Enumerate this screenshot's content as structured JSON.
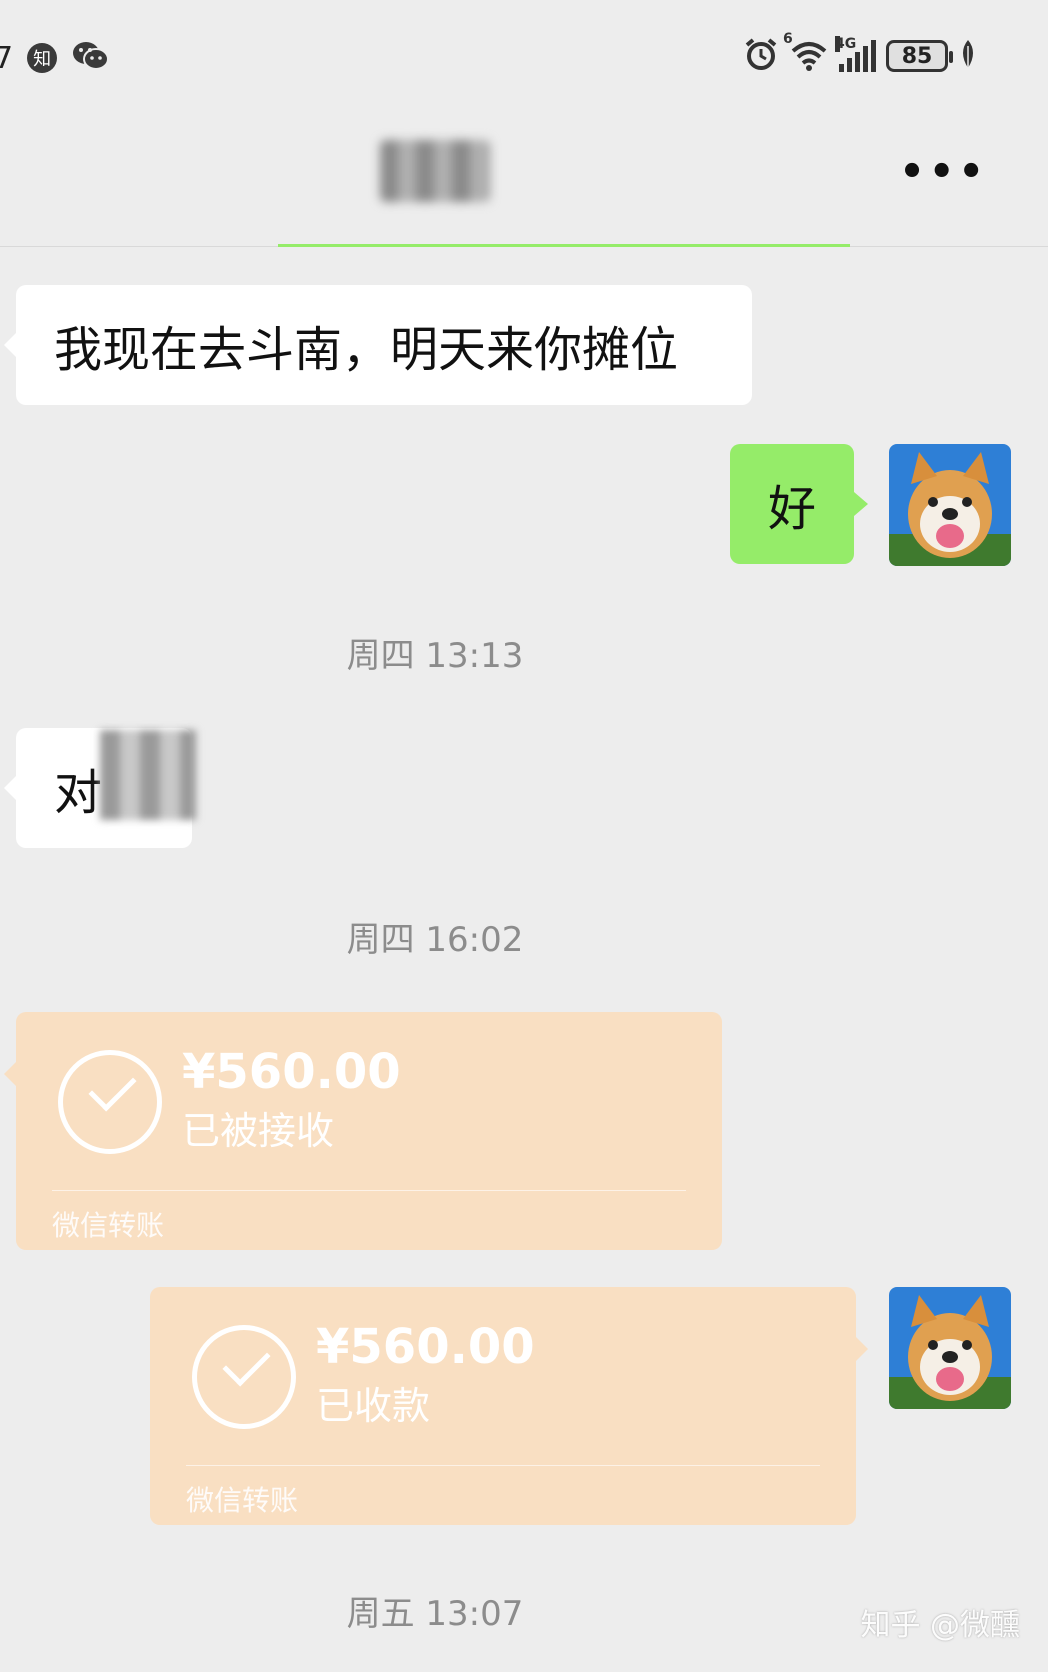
{
  "status_bar": {
    "clip_text": "7",
    "zhihu_label": "知",
    "wifi_label": "6",
    "network_label": "4G",
    "battery": "85"
  },
  "header": {
    "more_label": "•••"
  },
  "messages": [
    {
      "side": "left",
      "text": "我现在去斗南，明天来你摊位"
    },
    {
      "side": "right",
      "text": "好"
    },
    {
      "time": "周四 13:13"
    },
    {
      "side": "left",
      "text": "对"
    },
    {
      "time": "周四 16:02"
    },
    {
      "side": "left",
      "type": "transfer",
      "amount": "¥560.00",
      "status": "已被接收",
      "footer": "微信转账"
    },
    {
      "side": "right",
      "type": "transfer",
      "amount": "¥560.00",
      "status": "已收款",
      "footer": "微信转账"
    },
    {
      "time": "周五 13:07"
    }
  ],
  "watermark": "知乎 @微醺",
  "colors": {
    "background": "#ededed",
    "bubble_green": "#95ec69",
    "bubble_white": "#ffffff",
    "transfer_bg": "#f9dfc2",
    "timestamp": "#8c8c8c"
  },
  "icons": [
    "alarm-icon",
    "wifi-icon",
    "signal-icon",
    "battery-icon",
    "leaf-icon",
    "wechat-icon",
    "more-icon",
    "check-circle-icon"
  ]
}
